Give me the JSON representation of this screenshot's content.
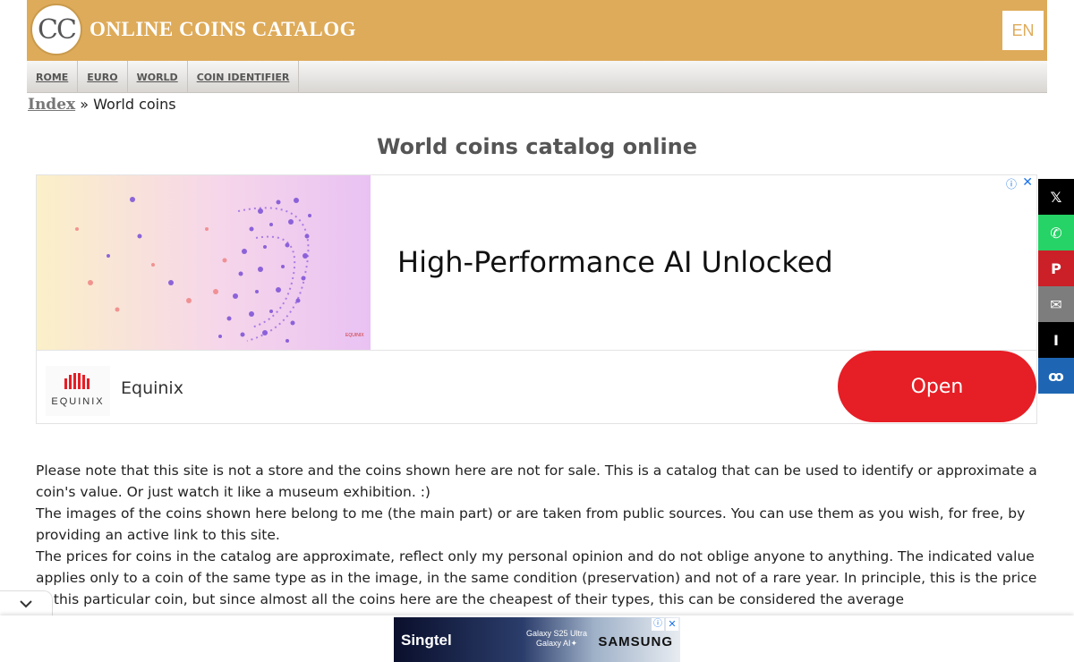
{
  "header": {
    "logo_text": "CC",
    "site_title": "ONLINE COINS CATALOG",
    "lang": "EN",
    "accent_color": "#deab5a"
  },
  "nav": {
    "items": [
      {
        "label": "ROME"
      },
      {
        "label": "EURO"
      },
      {
        "label": "WORLD"
      },
      {
        "label": "COIN IDENTIFIER"
      }
    ]
  },
  "breadcrumb": {
    "index": "Index",
    "separator": "»",
    "current": "World coins"
  },
  "page_title": "World coins catalog online",
  "ad": {
    "headline": "High-Performance AI Unlocked",
    "brand": "Equinix",
    "logo_text": "EQUINIX",
    "cta": "Open",
    "info_icon": "ⓘ",
    "close_icon": "✕",
    "cta_color": "#e61e25"
  },
  "share": {
    "items": [
      {
        "name": "x-share",
        "glyph": "𝕏",
        "color": "#000000"
      },
      {
        "name": "whatsapp-share",
        "glyph": "✆",
        "color": "#25d366"
      },
      {
        "name": "pinterest-share",
        "glyph": "P",
        "color": "#cb2027"
      },
      {
        "name": "email-share",
        "glyph": "✉",
        "color": "#7d7d7d"
      },
      {
        "name": "instapaper-share",
        "glyph": "I",
        "color": "#000000"
      },
      {
        "name": "myspace-share",
        "glyph": "ꝏ",
        "color": "#1e66b4"
      }
    ]
  },
  "body": {
    "paragraphs": [
      "Please note that this site is not a store and the coins shown here are not for sale. This is a catalog that can be used to identify or approximate a coin's value. Or just watch it like a museum exhibition. :)",
      "The images of the coins shown here belong to me (the main part) or are taken from public sources. You can use them as you wish, for free, by providing an active link to this site.",
      "The prices for coins in the catalog are approximate, reflect only my personal opinion and do not oblige anyone to anything. The indicated value applies only to a coin of the same type as in the image, in the same condition (preservation) and not of a rare year. In principle, this is the price of this particular coin, but since almost all the coins here are the cheapest of their types, this can be considered the average"
    ]
  },
  "bottom_ad": {
    "brand_left": "Singtel",
    "product_line1": "Galaxy S25 Ultra",
    "product_line2": "Galaxy AI✦",
    "brand_right": "SAMSUNG",
    "info_icon": "ⓘ",
    "close_icon": "✕"
  },
  "collapse_icon": "chevron-down-icon"
}
